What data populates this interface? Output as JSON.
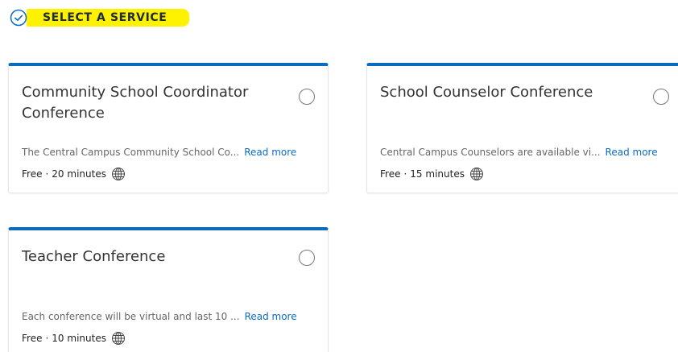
{
  "header": {
    "title": "SELECT A SERVICE",
    "icon": "check-circle-icon",
    "highlight_color": "#fff200",
    "icon_color": "#0a6cc1"
  },
  "accent_color": "#0a6cc1",
  "services": [
    {
      "title": "Community School Coordinator Conference",
      "description": "The Central Campus Community School Co...",
      "read_more": "Read more",
      "price": "Free",
      "separator": "·",
      "duration": "20 minutes",
      "icon": "globe-icon"
    },
    {
      "title": "School Counselor Conference",
      "description": "Central Campus Counselors are available vi...",
      "read_more": "Read more",
      "price": "Free",
      "separator": "·",
      "duration": "15 minutes",
      "icon": "globe-icon"
    },
    {
      "title": "Teacher Conference",
      "description": "Each conference will be virtual and last 10 ...",
      "read_more": "Read more",
      "price": "Free",
      "separator": "·",
      "duration": "10 minutes",
      "icon": "globe-icon"
    }
  ]
}
